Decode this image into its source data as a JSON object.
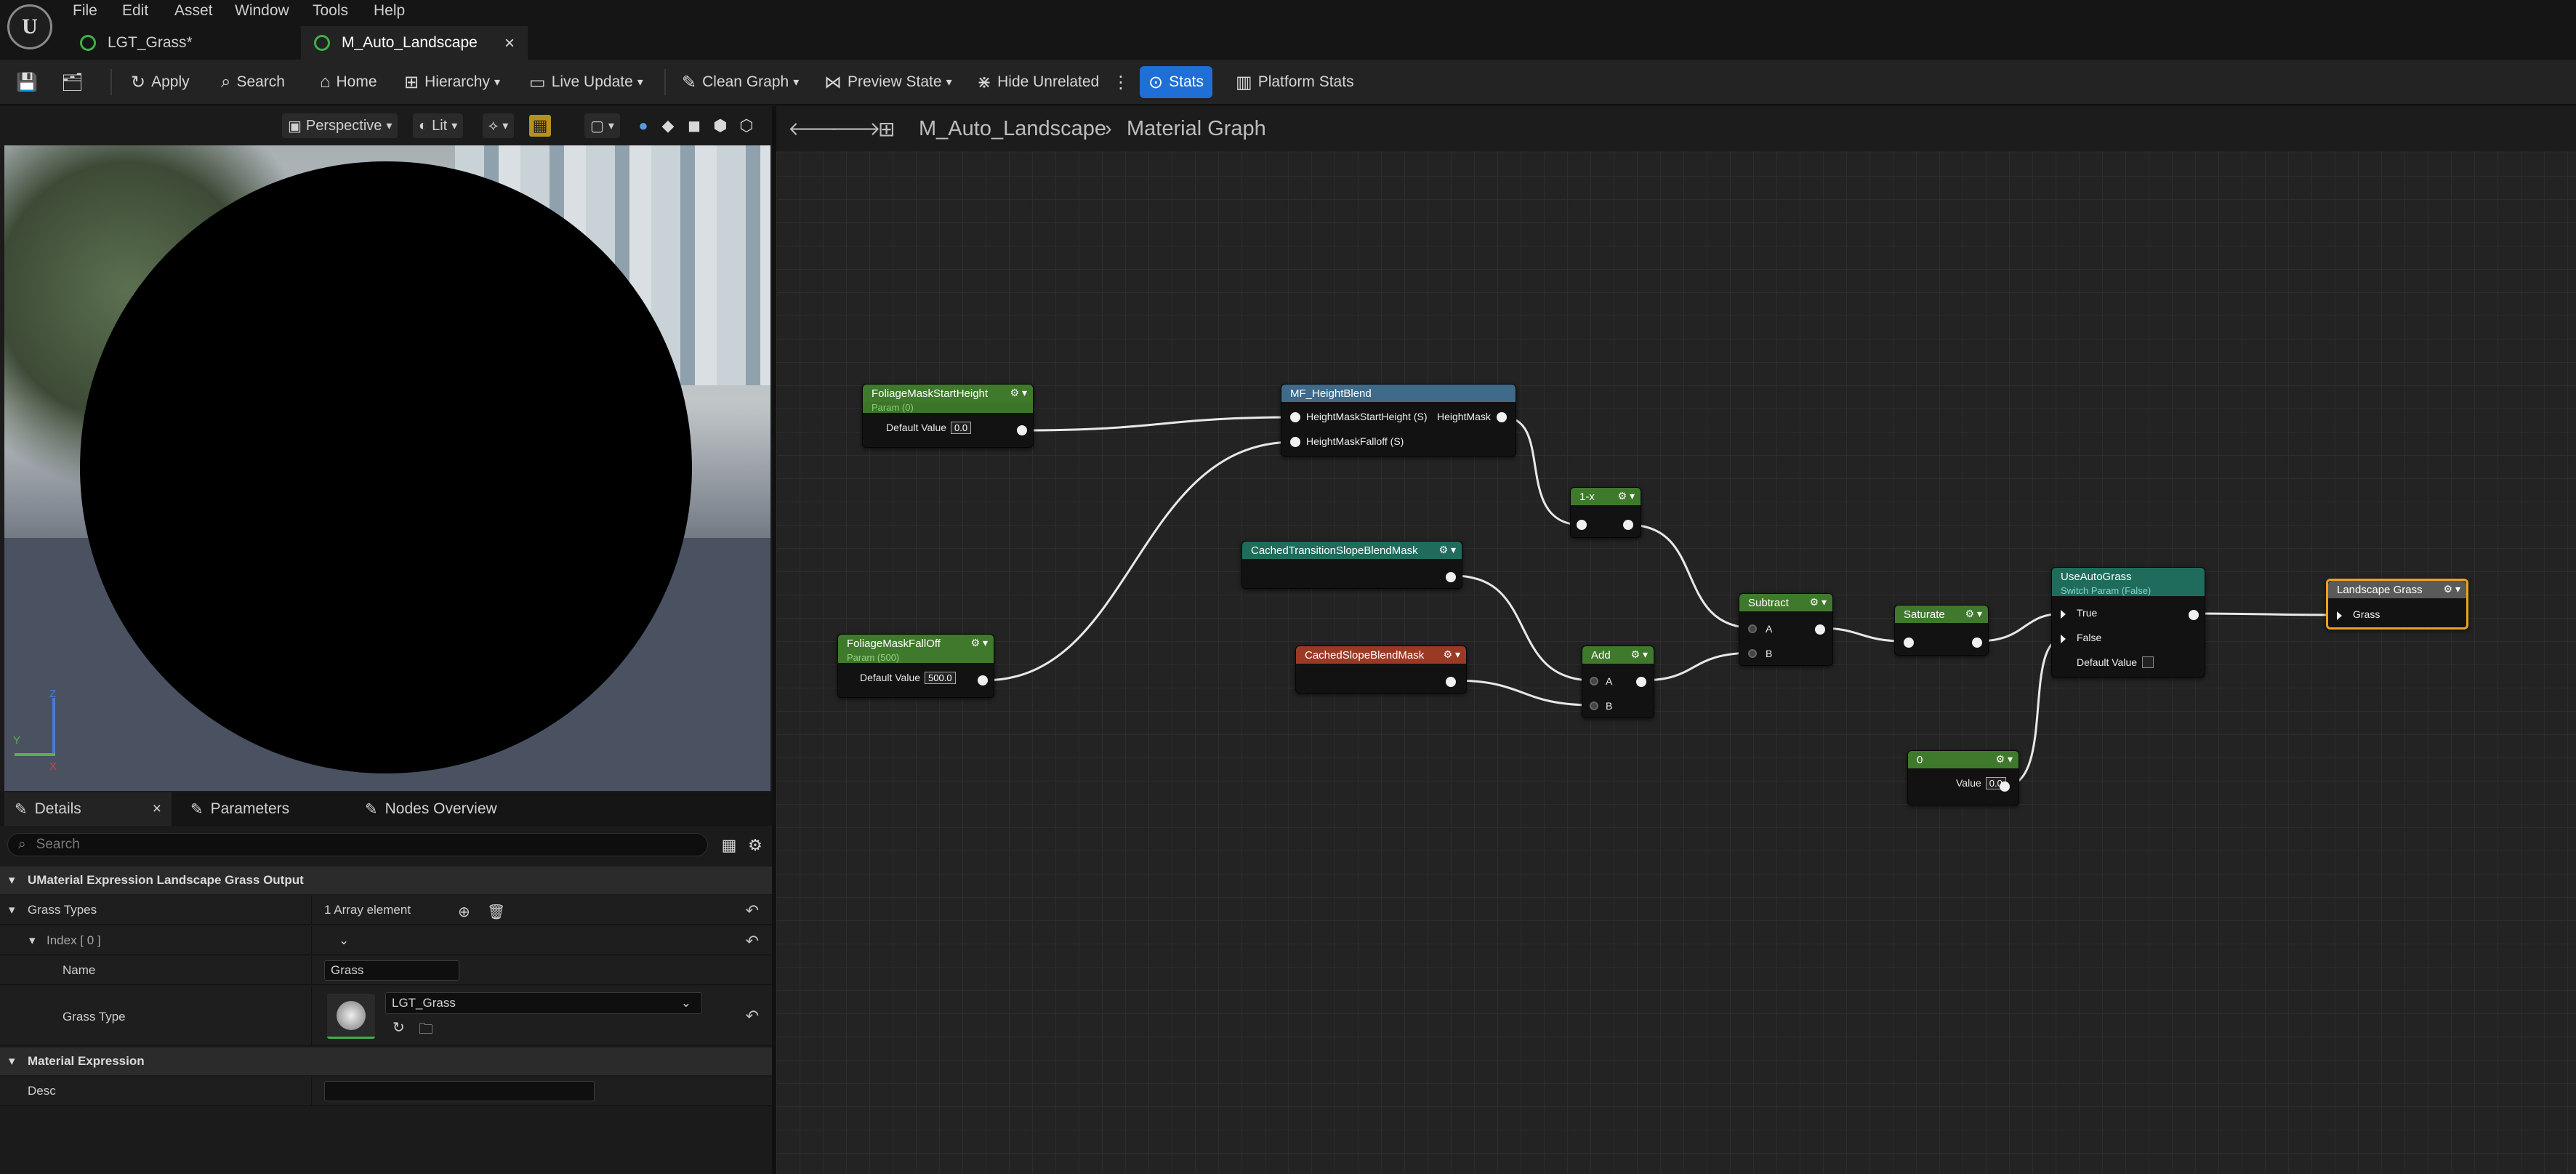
{
  "menu": {
    "items": [
      "File",
      "Edit",
      "Asset",
      "Window",
      "Tools",
      "Help"
    ]
  },
  "tabs": [
    {
      "label": "LGT_Grass*"
    },
    {
      "label": "M_Auto_Landscape"
    }
  ],
  "toolbar": {
    "apply": "Apply",
    "search": "Search",
    "home": "Home",
    "hierarchy": "Hierarchy",
    "live_update": "Live Update",
    "clean_graph": "Clean Graph",
    "preview_state": "Preview State",
    "hide_unrelated": "Hide Unrelated",
    "stats": "Stats",
    "platform_stats": "Platform Stats"
  },
  "viewport": {
    "perspective": "Perspective",
    "lit": "Lit",
    "axis_z": "Z",
    "axis_y": "Y",
    "axis_x": "X"
  },
  "details": {
    "tabs": [
      "Details",
      "Parameters",
      "Nodes Overview"
    ],
    "search_placeholder": "Search",
    "section_title": "UMaterial Expression Landscape Grass Output",
    "grass_types_label": "Grass Types",
    "grass_types_value": "1 Array element",
    "index_label": "Index [ 0 ]",
    "name_label": "Name",
    "name_value": "Grass",
    "grass_type_label": "Grass Type",
    "grass_type_value": "LGT_Grass",
    "section2_title": "Material Expression",
    "desc_label": "Desc",
    "desc_value": ""
  },
  "graph": {
    "breadcrumb_root": "M_Auto_Landscape",
    "breadcrumb_child": "Material Graph",
    "nodes": {
      "foliage_start": {
        "title": "FoliageMaskStartHeight",
        "sub": "Param (0)",
        "field": "Default Value",
        "value": "0.0"
      },
      "height_blend": {
        "title": "MF_HeightBlend",
        "in1": "HeightMaskStartHeight (S)",
        "in2": "HeightMaskFalloff (S)",
        "out": "HeightMask"
      },
      "one_minus": {
        "title": "1-x"
      },
      "cached_trans": {
        "title": "CachedTransitionSlopeBlendMask"
      },
      "cached_slope": {
        "title": "CachedSlopeBlendMask"
      },
      "foliage_falloff": {
        "title": "FoliageMaskFallOff",
        "sub": "Param (500)",
        "field": "Default Value",
        "value": "500.0"
      },
      "add": {
        "title": "Add",
        "a": "A",
        "b": "B"
      },
      "subtract": {
        "title": "Subtract",
        "a": "A",
        "b": "B"
      },
      "saturate": {
        "title": "Saturate"
      },
      "use_auto_grass": {
        "title": "UseAutoGrass",
        "sub": "Switch Param (False)",
        "true_label": "True",
        "false_label": "False",
        "default_label": "Default Value"
      },
      "landscape_grass": {
        "title": "Landscape Grass",
        "pin": "Grass"
      },
      "const": {
        "title": "0",
        "field": "Value",
        "value": "0.0"
      }
    }
  },
  "colors": {
    "accent": "#1f6fd6",
    "param_green": "#3f7a2c",
    "function_blue": "#3f6a8a",
    "red_node": "#9a3a25",
    "teal": "#1f6c5c",
    "selected": "#f0a020"
  }
}
